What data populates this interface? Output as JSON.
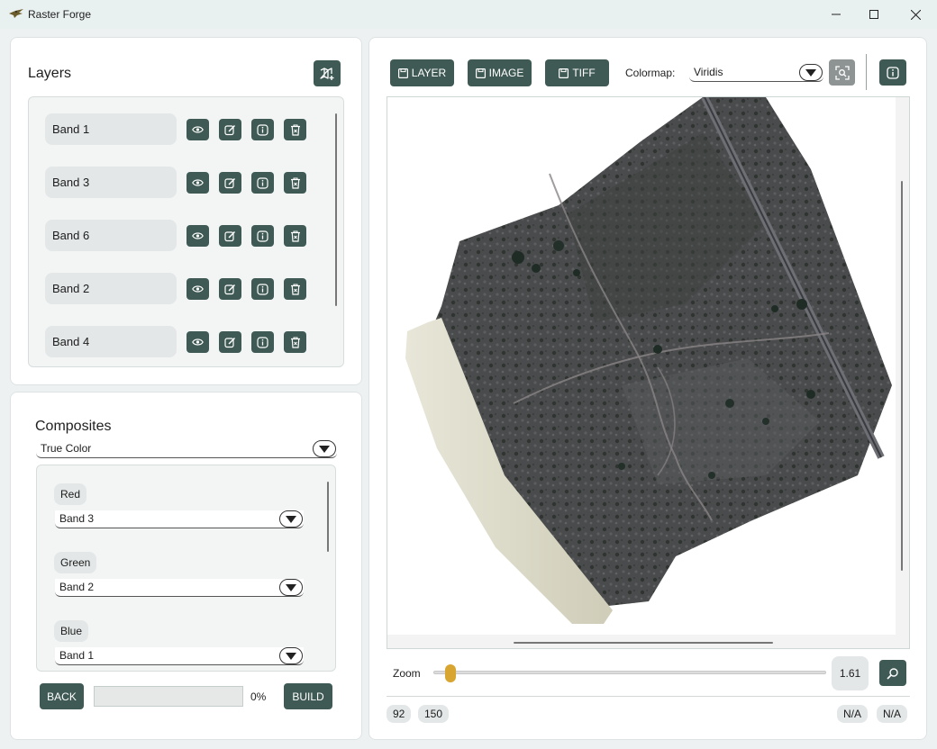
{
  "window": {
    "title": "Raster Forge",
    "icon": "falcon-logo",
    "controls": [
      "minimize-icon",
      "maximize-icon",
      "close-icon"
    ]
  },
  "layers": {
    "title": "Layers",
    "add_icon": "add-map-icon",
    "items": [
      {
        "label": "Band 1"
      },
      {
        "label": "Band 3"
      },
      {
        "label": "Band 6"
      },
      {
        "label": "Band 2"
      },
      {
        "label": "Band 4"
      }
    ],
    "row_actions": [
      "eye-icon",
      "edit-icon",
      "info-icon",
      "trash-icon"
    ]
  },
  "composites": {
    "title": "Composites",
    "selected": "True Color",
    "channels": [
      {
        "name": "Red",
        "band": "Band 3"
      },
      {
        "name": "Green",
        "band": "Band 2"
      },
      {
        "name": "Blue",
        "band": "Band 1"
      }
    ],
    "back_label": "BACK",
    "build_label": "BUILD",
    "progress_text": "0%",
    "progress_value": 0
  },
  "toolbar": {
    "layer_label": "LAYER",
    "image_label": "IMAGE",
    "tiff_label": "TIFF",
    "save_icon": "save-icon",
    "colormap_label": "Colormap:",
    "colormap_value": "Viridis",
    "fit_icon": "zoom-fit-icon",
    "info_icon": "info-icon"
  },
  "zoom": {
    "label": "Zoom",
    "value": "1.61",
    "slider_fraction": 0.03,
    "search_icon": "zoom-search-icon"
  },
  "status": {
    "x": "92",
    "y": "150",
    "value1": "N/A",
    "value2": "N/A"
  },
  "colors": {
    "accent": "#3f5a54",
    "slider": "#d8a531",
    "panel": "#ffffff",
    "background": "#eef1f1"
  }
}
